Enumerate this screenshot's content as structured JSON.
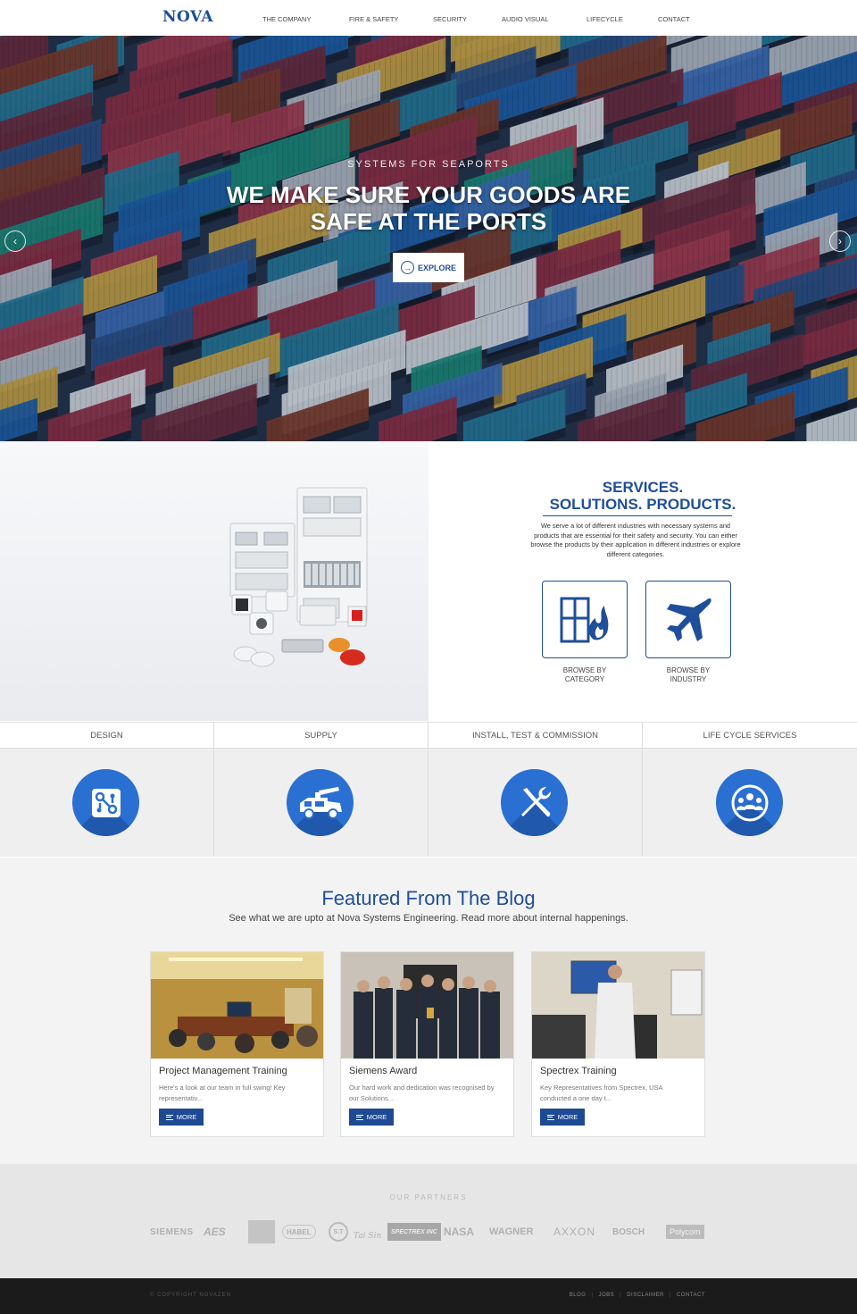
{
  "brand": {
    "logo_text": "NOVA",
    "logo_accent": "",
    "primary_color": "#1f4e9a",
    "accent_color": "#2a6fd2"
  },
  "nav": {
    "items": [
      {
        "label": "THE COMPANY"
      },
      {
        "label": "FIRE & SAFETY"
      },
      {
        "label": "SECURITY"
      },
      {
        "label": "AUDIO VISUAL"
      },
      {
        "label": "LIFECYCLE"
      },
      {
        "label": "CONTACT"
      }
    ]
  },
  "hero": {
    "subtitle": "SYSTEMS FOR SEAPORTS",
    "title_line1": "WE MAKE SURE YOUR GOODS ARE",
    "title_line2": "SAFE AT THE PORTS",
    "button_label": "EXPLORE",
    "prev_icon": "chevron-left-icon",
    "next_icon": "chevron-right-icon"
  },
  "services": {
    "title_line1": "SERVICES.",
    "title_line2": "SOLUTIONS. PRODUCTS.",
    "description": "We serve a lot of different industries with necessary systems and products that are essential for their safety and security. You can either browse the products by their application in different industries or explore different categories.",
    "browse_category_line1": "BROWSE BY",
    "browse_category_line2": "CATEGORY",
    "browse_industry_line1": "BROWSE BY",
    "browse_industry_line2": "INDUSTRY"
  },
  "process": [
    {
      "label": "DESIGN",
      "icon": "circuit-icon"
    },
    {
      "label": "SUPPLY",
      "icon": "truck-icon"
    },
    {
      "label": "INSTALL, TEST & COMMISSION",
      "icon": "tools-icon"
    },
    {
      "label": "LIFE CYCLE SERVICES",
      "icon": "team-icon"
    }
  ],
  "blog": {
    "title": "Featured From The Blog",
    "subtitle": "See what we are upto at Nova Systems Engineering. Read more about internal happenings.",
    "posts": [
      {
        "title": "Project Management Training",
        "excerpt": "Here's a look at our team in full swing! Key representativ...",
        "button": "MORE"
      },
      {
        "title": "Siemens Award",
        "excerpt": "Our hard work and dedication was recognised by our Solutions...",
        "button": "MORE"
      },
      {
        "title": "Spectrex Training",
        "excerpt": "Key Representatives from Spectrex, USA conducted a one day t...",
        "button": "MORE"
      }
    ]
  },
  "partners": {
    "title": "OUR PARTNERS",
    "logos": [
      "SIEMENS",
      "AES",
      "",
      "HABEL",
      "S.T",
      "Tai Sin",
      "SPECTREX INC",
      "NASA",
      "WAGNER",
      "AXXON",
      "BOSCH",
      "Polycom"
    ]
  },
  "footer": {
    "copyright": "© COPYRIGHT NOVAZEN",
    "links": [
      "BLOG",
      "JOBS",
      "DISCLAIMER",
      "CONTACT"
    ]
  }
}
